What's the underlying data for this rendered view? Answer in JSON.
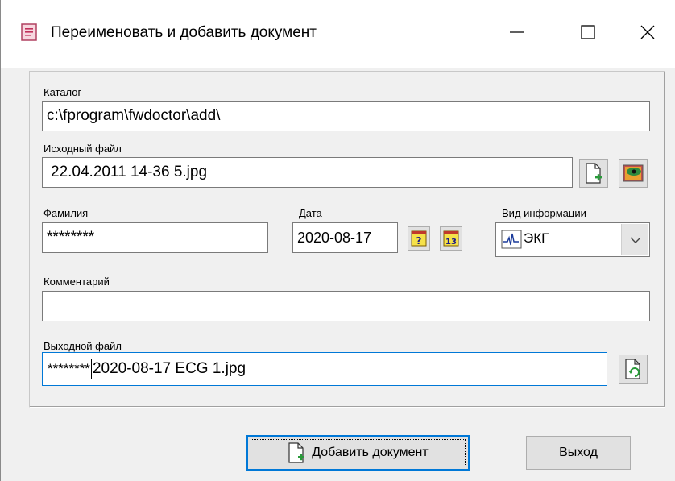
{
  "window": {
    "title": "Переименовать и добавить документ"
  },
  "form": {
    "catalog_label": "Каталог",
    "catalog_value": "c:\\fprogram\\fwdoctor\\add\\",
    "source_label": "Исходный файл",
    "source_value": "22.04.2011 14-36 5.jpg",
    "surname_label": "Фамилия",
    "surname_value": "********",
    "date_label": "Дата",
    "date_value": "2020-08-17",
    "info_type_label": "Вид информации",
    "info_type_value": "ЭКГ",
    "comment_label": "Комментарий",
    "comment_value": "",
    "output_label": "Выходной файл",
    "output_value_prefix": "********",
    "output_value_suffix": "2020-08-17 ECG 1.jpg",
    "calendar_icon_text": "13",
    "help_icon_text": "?"
  },
  "buttons": {
    "add_first_letter": "Д",
    "add_rest": "обавить документ",
    "exit": "Выход"
  },
  "icons": {
    "app": "document-app-icon",
    "new_file": "new-document-icon",
    "preview": "preview-image-icon",
    "help": "help-icon",
    "calendar": "calendar-icon",
    "ecg": "ecg-icon",
    "refresh": "refresh-document-icon",
    "add_doc": "add-document-icon"
  },
  "colors": {
    "accent": "#0078d7",
    "window_bg": "#f0f0f0"
  }
}
